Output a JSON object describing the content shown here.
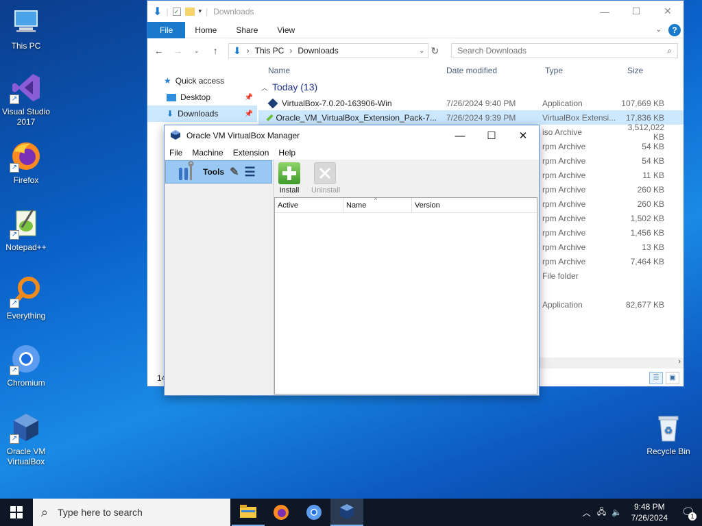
{
  "desktop": {
    "icons": [
      {
        "label": "This PC"
      },
      {
        "label": "Visual Studio 2017"
      },
      {
        "label": "Firefox"
      },
      {
        "label": "Notepad++"
      },
      {
        "label": "Everything"
      },
      {
        "label": "Chromium"
      },
      {
        "label": "Oracle VM VirtualBox"
      },
      {
        "label": "Recycle Bin"
      }
    ]
  },
  "explorer": {
    "title": "Downloads",
    "ribbon_tabs": [
      "File",
      "Home",
      "Share",
      "View"
    ],
    "breadcrumb": [
      "This PC",
      "Downloads"
    ],
    "search_placeholder": "Search Downloads",
    "nav_items": [
      "Quick access",
      "Desktop",
      "Downloads"
    ],
    "columns": [
      "Name",
      "Date modified",
      "Type",
      "Size"
    ],
    "group_label": "Today (13)",
    "files": [
      {
        "name": "VirtualBox-7.0.20-163906-Win",
        "date": "7/26/2024 9:40 PM",
        "type": "Application",
        "size": "107,669 KB"
      },
      {
        "name": "Oracle_VM_VirtualBox_Extension_Pack-7...",
        "date": "7/26/2024 9:39 PM",
        "type": "VirtualBox Extensi...",
        "size": "17,836 KB"
      },
      {
        "name": "",
        "date": "",
        "type": "iso Archive",
        "size": "3,512,022 KB"
      },
      {
        "name": "",
        "date": "",
        "type": "rpm Archive",
        "size": "54 KB"
      },
      {
        "name": "",
        "date": "",
        "type": "rpm Archive",
        "size": "54 KB"
      },
      {
        "name": "",
        "date": "",
        "type": "rpm Archive",
        "size": "11 KB"
      },
      {
        "name": "",
        "date": "",
        "type": "rpm Archive",
        "size": "260 KB"
      },
      {
        "name": "",
        "date": "",
        "type": "rpm Archive",
        "size": "260 KB"
      },
      {
        "name": "",
        "date": "",
        "type": "rpm Archive",
        "size": "1,502 KB"
      },
      {
        "name": "",
        "date": "",
        "type": "rpm Archive",
        "size": "1,456 KB"
      },
      {
        "name": "",
        "date": "",
        "type": "rpm Archive",
        "size": "13 KB"
      },
      {
        "name": "",
        "date": "",
        "type": "rpm Archive",
        "size": "7,464 KB"
      },
      {
        "name": "",
        "date": "",
        "type": "File folder",
        "size": ""
      }
    ],
    "extra_file": {
      "type": "Application",
      "size": "82,677 KB"
    },
    "status_count": "14"
  },
  "vbox": {
    "title": "Oracle VM VirtualBox Manager",
    "menu": [
      "File",
      "Machine",
      "Extension",
      "Help"
    ],
    "tools_label": "Tools",
    "toolbar": {
      "install": "Install",
      "uninstall": "Uninstall"
    },
    "ext_columns": [
      "Active",
      "Name",
      "Version"
    ]
  },
  "taskbar": {
    "search_placeholder": "Type here to search",
    "time": "9:48 PM",
    "date": "7/26/2024",
    "notif_count": "1"
  },
  "colors": {
    "accent": "#1979ca",
    "selection": "#cce8ff",
    "vbox_tools": "#99c9f3"
  }
}
